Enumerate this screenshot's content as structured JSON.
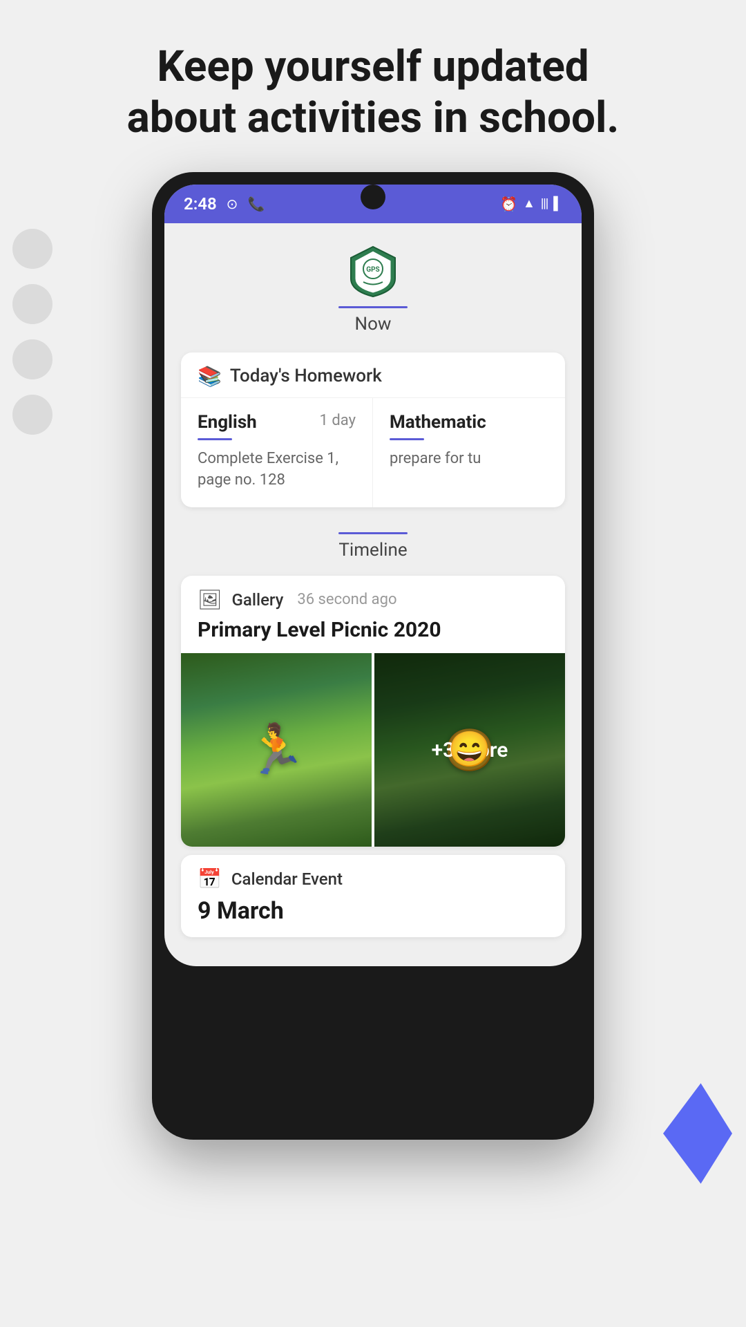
{
  "page": {
    "headline_line1": "Keep yourself updated",
    "headline_line2": "about activities in school."
  },
  "statusbar": {
    "time": "2:48",
    "wifi": "▲",
    "battery": "▌"
  },
  "school": {
    "logo_alt": "School crest"
  },
  "now_tab": {
    "label": "Now"
  },
  "homework": {
    "section_title": "Today's Homework",
    "subjects": [
      {
        "name": "English",
        "days": "1 day",
        "description": "Complete Exercise 1, page no. 128"
      },
      {
        "name": "Mathematic",
        "days": "",
        "description": "prepare for tu"
      }
    ]
  },
  "timeline_tab": {
    "label": "Timeline"
  },
  "gallery_post": {
    "type": "Gallery",
    "time": "36 second ago",
    "title": "Primary Level Picnic 2020",
    "more_count": "+3 more"
  },
  "calendar_post": {
    "type": "Calendar Event",
    "date": "9 March"
  }
}
